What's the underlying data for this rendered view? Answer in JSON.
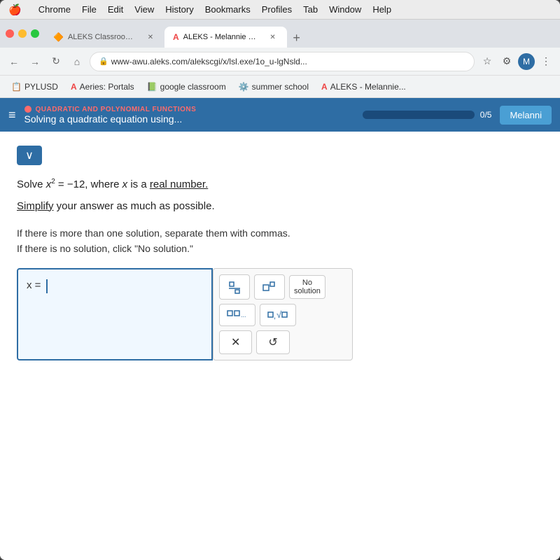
{
  "os": {
    "menubar": {
      "apple": "🍎",
      "items": [
        "Chrome",
        "File",
        "Edit",
        "View",
        "History",
        "Bookmarks",
        "Profiles",
        "Tab",
        "Window",
        "Help"
      ]
    }
  },
  "browser": {
    "window_controls": {
      "red": "#ff5f57",
      "yellow": "#febc2e",
      "green": "#28c840"
    },
    "tabs": [
      {
        "label": "ALEKS Classroom Link",
        "active": false,
        "favicon": "🔶"
      },
      {
        "label": "ALEKS - Melannie Pina - Learn",
        "active": true,
        "favicon": "A"
      }
    ],
    "address": "www-awu.aleks.com/alekscgi/x/lsl.exe/1o_u-lgNsld...",
    "bookmarks": [
      {
        "label": "PYLUSD",
        "favicon": "📋"
      },
      {
        "label": "Aeries: Portals",
        "favicon": "A"
      },
      {
        "label": "google classroom",
        "favicon": "📗"
      },
      {
        "label": "summer school",
        "favicon": "⚙️"
      },
      {
        "label": "ALEKS - Melannie...",
        "favicon": "A"
      }
    ]
  },
  "aleks": {
    "header": {
      "topic_category": "QUADRATIC AND POLYNOMIAL FUNCTIONS",
      "topic_title": "Solving a quadratic equation using...",
      "progress": "0/5",
      "user": "Melanni"
    },
    "problem": {
      "solve_text": "Solve x² = −12, where x is a",
      "real_number_link": "real number.",
      "simplify_text": "Simplify your answer as much as possible.",
      "instructions_line1": "If there is more than one solution, separate them with commas.",
      "instructions_line2": "If there is no solution, click \"No solution.\"",
      "x_equals": "x ="
    },
    "keyboard": {
      "no_solution": "No\nsolution",
      "buttons": [
        {
          "label": "⬜/⬜",
          "symbol": "fraction"
        },
        {
          "label": "□□",
          "symbol": "superscript"
        },
        {
          "label": "□,□,...",
          "symbol": "list"
        },
        {
          "label": "□√□",
          "symbol": "sqrt"
        },
        {
          "label": "✕",
          "symbol": "clear"
        },
        {
          "label": "↺",
          "symbol": "undo"
        }
      ]
    }
  }
}
